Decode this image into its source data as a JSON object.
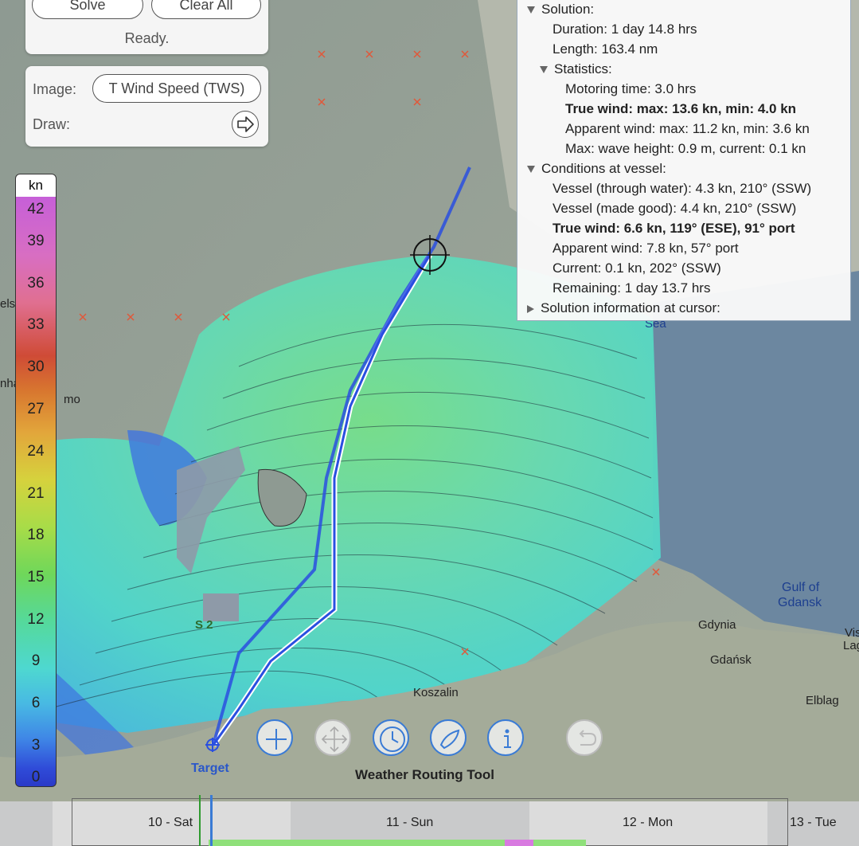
{
  "controls": {
    "solve_label": "Solve",
    "clear_label": "Clear All",
    "status": "Ready."
  },
  "image_panel": {
    "image_label": "Image:",
    "image_value": "T Wind Speed (TWS)",
    "draw_label": "Draw:"
  },
  "solution": {
    "header": "Solution:",
    "duration": "Duration: 1 day 14.8 hrs",
    "length": "Length: 163.4 nm",
    "statistics_header": "Statistics:",
    "motoring": "Motoring time: 3.0 hrs",
    "true_wind": "True wind: max: 13.6 kn, min: 4.0 kn",
    "apparent_wind": "Apparent wind: max: 11.2 kn, min: 3.6 kn",
    "max_wave": "Max: wave height: 0.9 m, current: 0.1 kn",
    "conditions_header": "Conditions at vessel:",
    "vessel_water": "Vessel (through water): 4.3 kn, 210° (SSW)",
    "vessel_good": "Vessel (made good): 4.4 kn, 210° (SSW)",
    "true_wind_vessel": "True wind: 6.6 kn, 119° (ESE), 91° port",
    "apparent_wind_vessel": "Apparent wind: 7.8 kn, 57° port",
    "current": "Current: 0.1 kn, 202° (SSW)",
    "remaining": "Remaining: 1 day 13.7 hrs",
    "cursor_header": "Solution information at cursor:"
  },
  "scale": {
    "unit": "kn",
    "ticks": [
      "42",
      "39",
      "36",
      "33",
      "30",
      "27",
      "24",
      "21",
      "18",
      "15",
      "12",
      "9",
      "6",
      "3",
      "0"
    ]
  },
  "map_labels": {
    "target": "Target",
    "s2": "S 2",
    "koszalin": "Koszalin",
    "gdynia": "Gdynia",
    "gdansk": "Gdańsk",
    "gulf_1": "Gulf of",
    "gulf_2": "Gdansk",
    "elblag": "Elblag",
    "vis": "Vis",
    "lag": "Lag",
    "sea": "Sea",
    "elsi": "elsi",
    "nha": "nha",
    "mo": "mo"
  },
  "toolbar": {
    "title": "Weather Routing Tool",
    "icons": [
      "plus-icon",
      "move-icon",
      "clock-icon",
      "boat-icon",
      "info-icon",
      "undo-icon"
    ]
  },
  "timeline": {
    "days": [
      "10 - Sat",
      "11 - Sun",
      "12 - Mon",
      "13 - Tue"
    ]
  },
  "colors": {
    "route": "#2a4fe0",
    "accent": "#3a7bd5"
  }
}
